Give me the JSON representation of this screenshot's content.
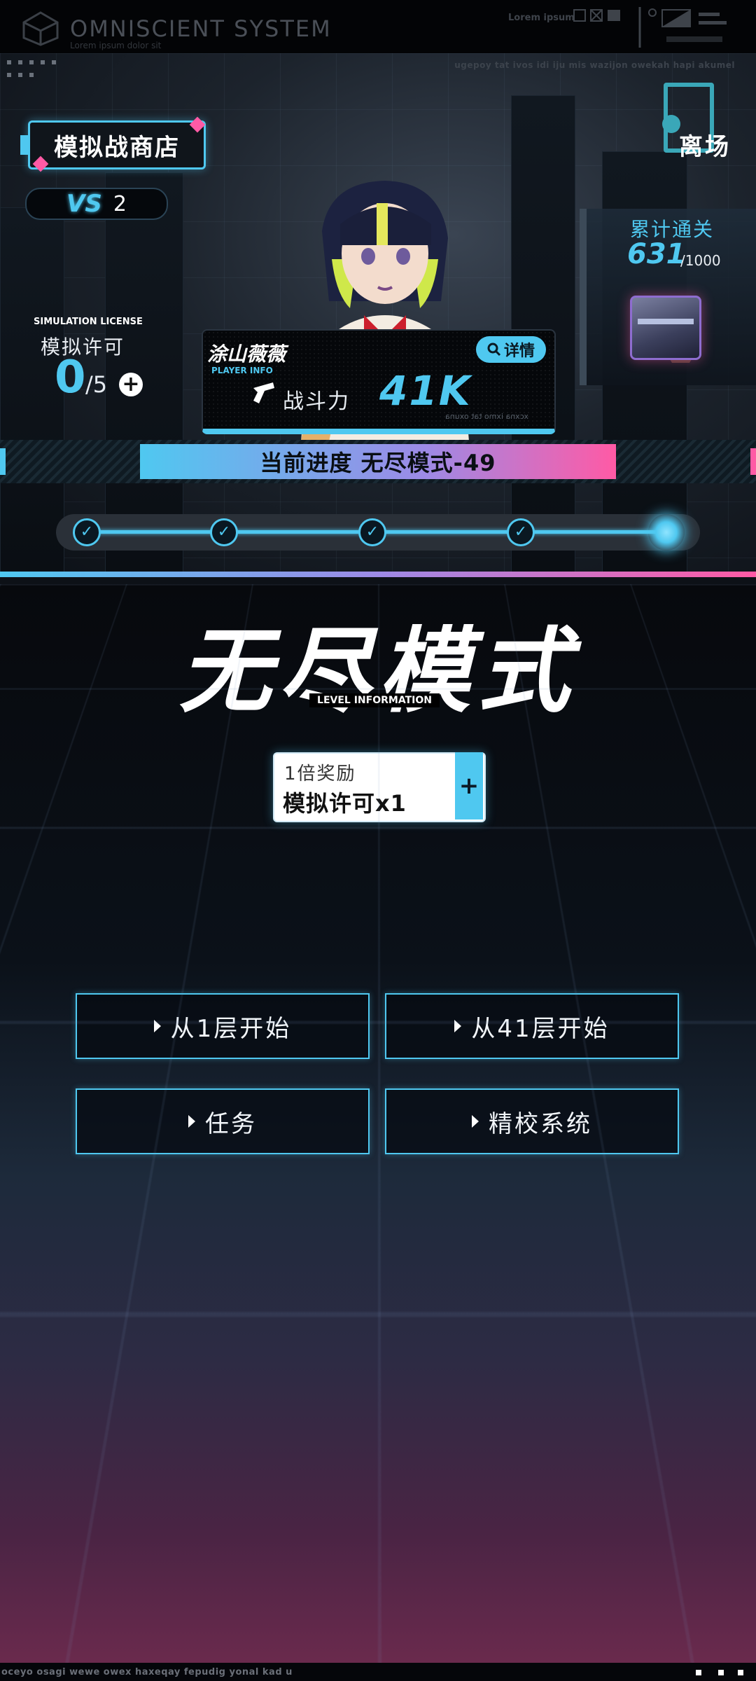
{
  "system": {
    "title": "OMNISCIENT  SYSTEM",
    "subtitle": "Lorem ipsum dolor sit",
    "lorem": "Lorem ipsum"
  },
  "hero": {
    "scroll_text": "ugepoy tat ivos idi iju mis wazijon owekah hapi akumel",
    "shop_label": "模拟战商店",
    "vs_count": "2",
    "vs_logo": "VS",
    "license": {
      "label_en": "SIMULATION LICENSE",
      "label_cn": "模拟许可",
      "current": "0",
      "max": "/5",
      "add_icon": "plus-circle-icon"
    },
    "exit_label": "离场",
    "clear": {
      "title": "累计通关",
      "count": "631",
      "total": "/1000"
    },
    "player": {
      "name": "涂山薇薇",
      "info_en": "PLAYER INFO",
      "detail_label": "详情",
      "power_label": "战斗力",
      "power_value": "41K",
      "ghost_text": "xcxna ixmo tat oxuna"
    }
  },
  "progress": {
    "label": "当前进度 无尽模式-49",
    "stages": [
      {
        "state": "cleared",
        "icon": "check-icon"
      },
      {
        "state": "cleared",
        "icon": "check-icon"
      },
      {
        "state": "cleared",
        "icon": "check-icon"
      },
      {
        "state": "cleared",
        "icon": "check-icon"
      },
      {
        "state": "current",
        "icon": "glow-dot-icon"
      }
    ]
  },
  "mode": {
    "title": "无尽模式",
    "level_info": "LEVEL INFORMATION",
    "reward": {
      "multiplier": "1倍奖励",
      "item": "模拟许可x1",
      "plus": "+"
    }
  },
  "actions": [
    {
      "label": "从1层开始"
    },
    {
      "label": "从41层开始"
    },
    {
      "label": "任务"
    },
    {
      "label": "精校系统"
    }
  ],
  "footer": {
    "ticker": "oceyo osagi wewe owex haxeqay fepudig yonal kad u"
  },
  "colors": {
    "accent": "#4fc8f0",
    "pink": "#ff5aa5",
    "purple": "#9d8ae6"
  }
}
